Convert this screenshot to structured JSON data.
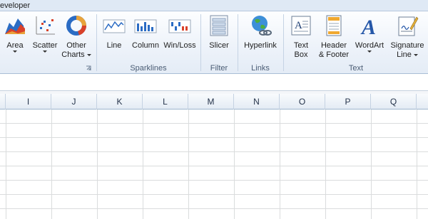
{
  "tabs": {
    "developer": "eveloper"
  },
  "ribbon": {
    "charts_group": {
      "area": "Area",
      "scatter": "Scatter",
      "other_charts_line1": "Other",
      "other_charts_line2": "Charts"
    },
    "sparklines_group": {
      "label": "Sparklines",
      "line": "Line",
      "column": "Column",
      "winloss": "Win/Loss"
    },
    "filter_group": {
      "label": "Filter",
      "slicer": "Slicer"
    },
    "links_group": {
      "label": "Links",
      "hyperlink": "Hyperlink"
    },
    "text_group": {
      "label": "Text",
      "textbox_line1": "Text",
      "textbox_line2": "Box",
      "header_line1": "Header",
      "header_line2": "& Footer",
      "wordart": "WordArt",
      "signature_line1": "Signature",
      "signature_line2": "Line"
    }
  },
  "columns": [
    "I",
    "J",
    "K",
    "L",
    "M",
    "N",
    "O",
    "P",
    "Q"
  ],
  "colors": {
    "ribbon_bg": "#eef3fa",
    "accent_blue": "#2b6cc4",
    "grid_line": "#dadcdd",
    "header_bg": "#e4ebf4"
  }
}
